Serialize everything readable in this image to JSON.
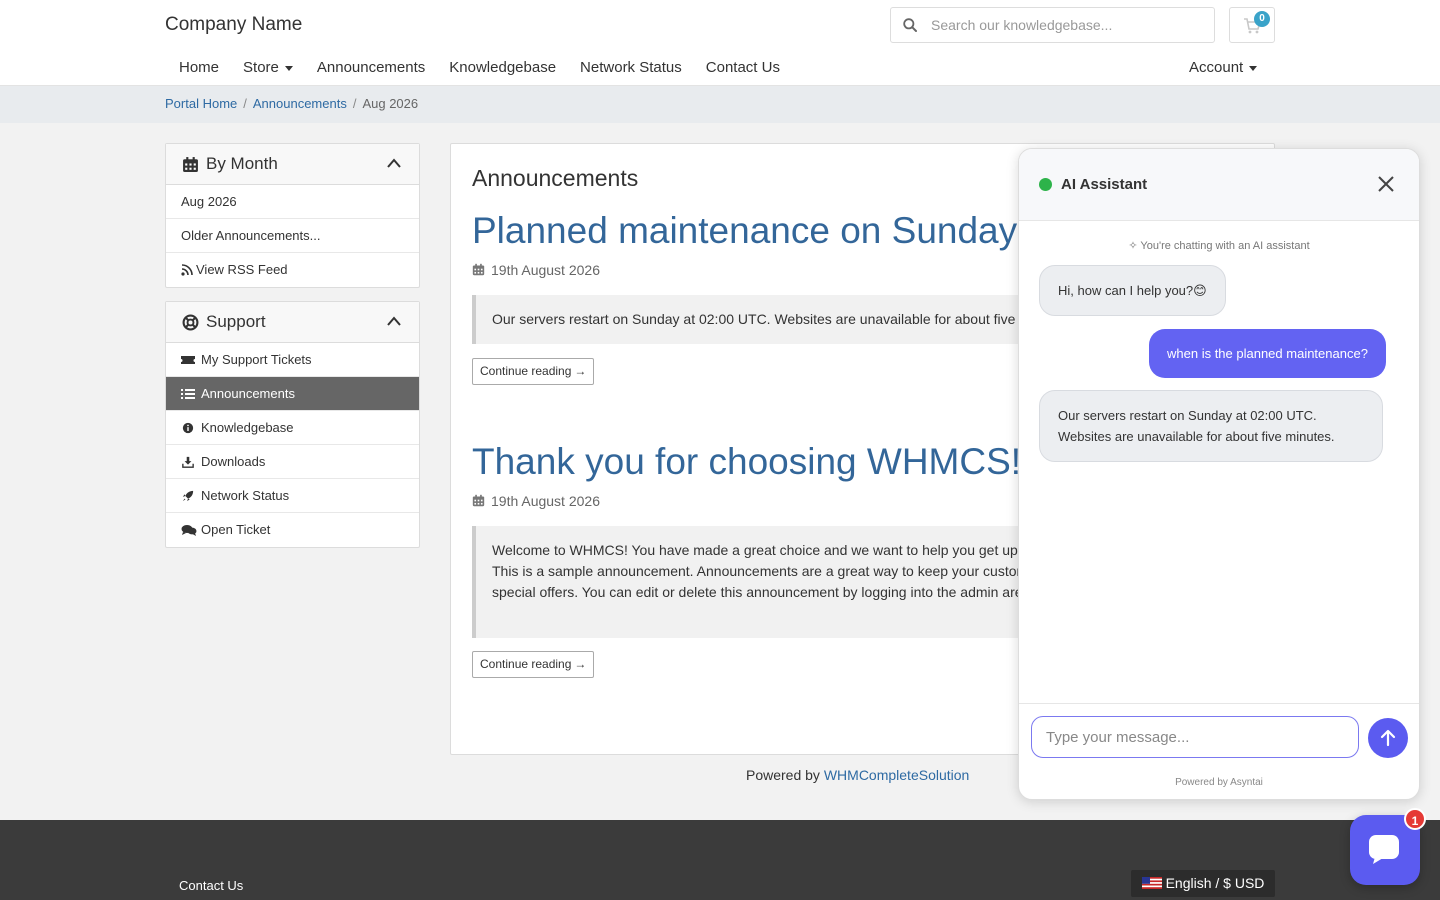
{
  "header": {
    "brand": "Company Name",
    "search_placeholder": "Search our knowledgebase...",
    "cart_count": "0"
  },
  "nav": {
    "home": "Home",
    "store": "Store",
    "announcements": "Announcements",
    "knowledgebase": "Knowledgebase",
    "network_status": "Network Status",
    "contact_us": "Contact Us",
    "account": "Account"
  },
  "breadcrumb": {
    "portal_home": "Portal Home",
    "announcements": "Announcements",
    "current": "Aug 2026",
    "sep": "/"
  },
  "sidebar": {
    "by_month": {
      "title": "By Month",
      "items": [
        "Aug 2026",
        "Older Announcements...",
        "View RSS Feed"
      ]
    },
    "support": {
      "title": "Support",
      "items": [
        "My Support Tickets",
        "Announcements",
        "Knowledgebase",
        "Downloads",
        "Network Status",
        "Open Ticket"
      ]
    }
  },
  "main": {
    "title": "Announcements",
    "announcements": [
      {
        "title": "Planned maintenance on Sunday",
        "date": "19th August 2026",
        "body": "Our servers restart on Sunday at 02:00 UTC. Websites are unavailable for about five minutes.",
        "button": "Continue reading"
      },
      {
        "title": "Thank you for choosing WHMCS!",
        "date": "19th August 2026",
        "body": "Welcome to WHMCS! You have made a great choice and we want to help you get up and running as quickly as possible. This is a sample announcement. Announcements are a great way to keep your customers informed about news and special offers. You can edit or delete this announcement by logging into the admin area and navigating to Support > ...",
        "button": "Continue reading"
      }
    ]
  },
  "powered": {
    "prefix": "Powered by",
    "link": "WHMCompleteSolution"
  },
  "footer": {
    "contact": "Contact Us",
    "language": "English / $ USD"
  },
  "chat": {
    "title": "AI Assistant",
    "note": "You're chatting with an AI assistant",
    "messages": [
      {
        "role": "bot",
        "text": "Hi, how can I help you?😊"
      },
      {
        "role": "user",
        "text": "when is the planned maintenance?"
      },
      {
        "role": "bot",
        "text": "Our servers restart on Sunday at 02:00 UTC. Websites are unavailable for about five minutes."
      }
    ],
    "input_placeholder": "Type your message...",
    "powered": "Powered by Asyntai",
    "launcher_badge": "1"
  },
  "colors": {
    "link": "#2e6aa3",
    "title": "#336699",
    "accent": "#5b5bf0",
    "status_online": "#2db34a"
  }
}
